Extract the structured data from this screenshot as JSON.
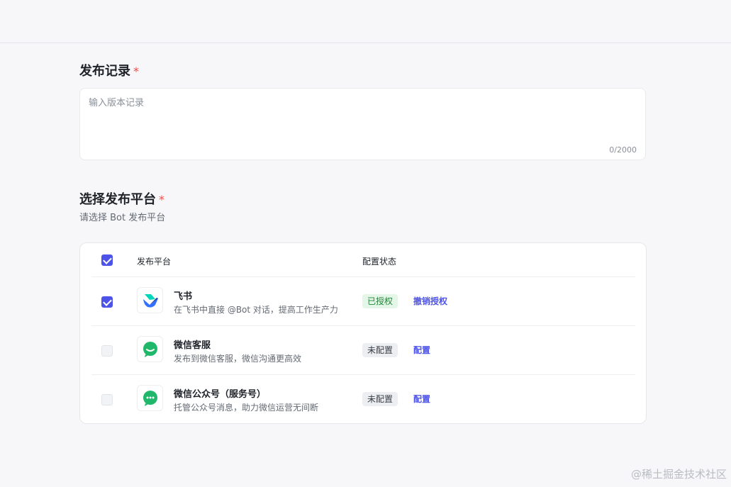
{
  "release_notes": {
    "title": "发布记录",
    "required_mark": "*",
    "placeholder": "输入版本记录",
    "counter": "0/2000"
  },
  "platform_section": {
    "title": "选择发布平台",
    "required_mark": "*",
    "subtitle": "请选择 Bot 发布平台"
  },
  "table": {
    "headers": {
      "platform": "发布平台",
      "status": "配置状态"
    },
    "header_checked": true,
    "rows": [
      {
        "name": "飞书",
        "desc": "在飞书中直接 @Bot 对话，提高工作生产力",
        "status": "已授权",
        "status_kind": "authorized",
        "action": "撤销授权",
        "checked": true,
        "icon": "feishu-logo-icon"
      },
      {
        "name": "微信客服",
        "desc": "发布到微信客服，微信沟通更高效",
        "status": "未配置",
        "status_kind": "unconfigured",
        "action": "配置",
        "checked": false,
        "icon": "wechat-service-icon"
      },
      {
        "name": "微信公众号（服务号）",
        "desc": "托管公众号消息，助力微信运营无间断",
        "status": "未配置",
        "status_kind": "unconfigured",
        "action": "配置",
        "checked": false,
        "icon": "wechat-official-account-icon"
      }
    ]
  },
  "colors": {
    "accent": "#4d53e8",
    "required": "#f54a45",
    "authorized_bg": "#e3f6e7",
    "authorized_text": "#25853a",
    "wechat_green": "#1fb86a"
  },
  "watermark": "@稀土掘金技术社区"
}
